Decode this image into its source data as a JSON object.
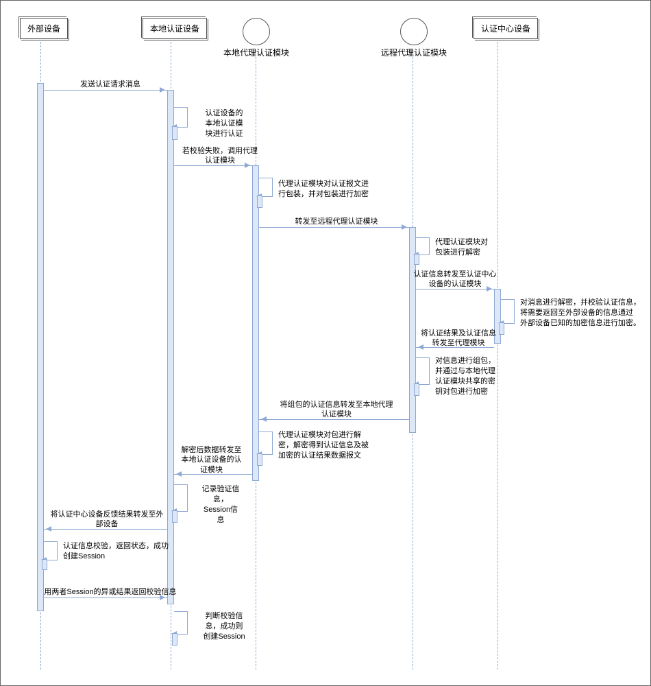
{
  "participants": {
    "external": "外部设备",
    "local_auth": "本地认证设备",
    "local_proxy": "本地代理认证模块",
    "remote_proxy": "远程代理认证模块",
    "auth_center": "认证中心设备"
  },
  "messages": {
    "m1": "发送认证请求消息",
    "m2": "认证设备的\n本地认证模\n块进行认证",
    "m3": "若校验失败，调用代理\n认证模块",
    "m4": "代理认证模块对认证报文进\n行包装，并对包装进行加密",
    "m5": "转发至远程代理认证模块",
    "m6": "代理认证模块对\n包装进行解密",
    "m7": "认证信息转发至认证中心\n设备的认证模块",
    "m8": "对消息进行解密，并校验认证信息，\n将需要返回至外部设备的信息通过\n外部设备已知的加密信息进行加密。",
    "m9": "将认证结果及认证信息\n转发至代理模块",
    "m10": "对信息进行组包，\n并通过与本地代理\n认证模块共享的密\n钥对包进行加密",
    "m11": "将组包的认证信息转发至本地代理\n认证模块",
    "m12": "代理认证模块对包进行解\n密，解密得到认证信息及被\n加密的认证结果数据报文",
    "m13": "解密后数据转发至\n本地认证设备的认\n证模块",
    "m14": "记录验证信\n息，\nSession信\n息",
    "m15": "将认证中心设备反馈结果转发至外\n部设备",
    "m16": "认证信息校验，返回状态，成功\n创建Session",
    "m17": "用两者Session的异或结果返回校验信息",
    "m18": "判断校验信\n息，成功则\n创建Session"
  },
  "chart_data": {
    "type": "sequence_diagram",
    "participants": [
      {
        "id": "external",
        "name": "外部设备",
        "kind": "actor"
      },
      {
        "id": "local_auth",
        "name": "本地认证设备",
        "kind": "actor"
      },
      {
        "id": "local_proxy",
        "name": "本地代理认证模块",
        "kind": "control"
      },
      {
        "id": "remote_proxy",
        "name": "远程代理认证模块",
        "kind": "control"
      },
      {
        "id": "auth_center",
        "name": "认证中心设备",
        "kind": "actor"
      }
    ],
    "interactions": [
      {
        "from": "external",
        "to": "local_auth",
        "label": "发送认证请求消息"
      },
      {
        "from": "local_auth",
        "to": "local_auth",
        "label": "认证设备的本地认证模块进行认证"
      },
      {
        "from": "local_auth",
        "to": "local_proxy",
        "label": "若校验失败，调用代理认证模块"
      },
      {
        "from": "local_proxy",
        "to": "local_proxy",
        "label": "代理认证模块对认证报文进行包装，并对包装进行加密"
      },
      {
        "from": "local_proxy",
        "to": "remote_proxy",
        "label": "转发至远程代理认证模块"
      },
      {
        "from": "remote_proxy",
        "to": "remote_proxy",
        "label": "代理认证模块对包装进行解密"
      },
      {
        "from": "remote_proxy",
        "to": "auth_center",
        "label": "认证信息转发至认证中心设备的认证模块"
      },
      {
        "from": "auth_center",
        "to": "auth_center",
        "label": "对消息进行解密，并校验认证信息，将需要返回至外部设备的信息通过外部设备已知的加密信息进行加密。"
      },
      {
        "from": "auth_center",
        "to": "remote_proxy",
        "label": "将认证结果及认证信息转发至代理模块"
      },
      {
        "from": "remote_proxy",
        "to": "remote_proxy",
        "label": "对信息进行组包，并通过与本地代理认证模块共享的密钥对包进行加密"
      },
      {
        "from": "remote_proxy",
        "to": "local_proxy",
        "label": "将组包的认证信息转发至本地代理认证模块"
      },
      {
        "from": "local_proxy",
        "to": "local_proxy",
        "label": "代理认证模块对包进行解密，解密得到认证信息及被加密的认证结果数据报文"
      },
      {
        "from": "local_proxy",
        "to": "local_auth",
        "label": "解密后数据转发至本地认证设备的认证模块"
      },
      {
        "from": "local_auth",
        "to": "local_auth",
        "label": "记录验证信息，Session信息"
      },
      {
        "from": "local_auth",
        "to": "external",
        "label": "将认证中心设备反馈结果转发至外部设备"
      },
      {
        "from": "external",
        "to": "external",
        "label": "认证信息校验，返回状态，成功创建Session"
      },
      {
        "from": "external",
        "to": "local_auth",
        "label": "用两者Session的异或结果返回校验信息"
      },
      {
        "from": "local_auth",
        "to": "local_auth",
        "label": "判断校验信息，成功则创建Session"
      }
    ]
  }
}
